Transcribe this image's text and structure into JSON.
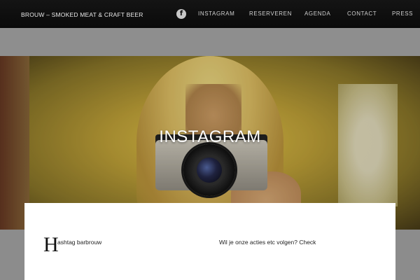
{
  "site": {
    "title": "BROUW – SMOKED MEAT & CRAFT BEER"
  },
  "nav": {
    "facebook_glyph": "f",
    "items": [
      {
        "label": "INSTAGRAM"
      },
      {
        "label": "RESERVEREN"
      },
      {
        "label": "AGENDA"
      },
      {
        "label": "CONTACT"
      },
      {
        "label": "PRESS"
      }
    ]
  },
  "hero": {
    "title": "INSTAGRAM"
  },
  "content": {
    "dropcap": "H",
    "left_text": "ashtag barbrouw",
    "right_text": "Wil je onze acties etc volgen? Check"
  },
  "icons": [
    "facebook-icon"
  ]
}
